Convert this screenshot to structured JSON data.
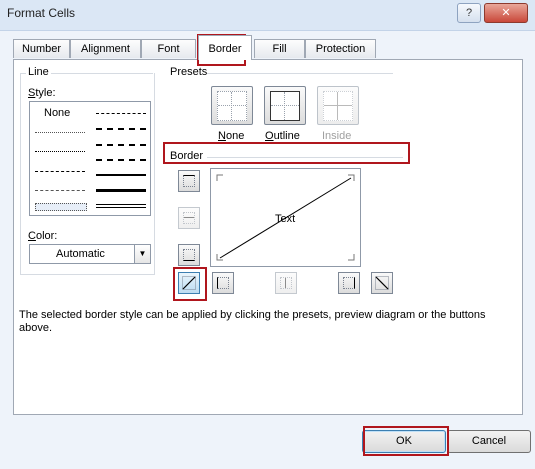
{
  "window": {
    "title": "Format Cells",
    "help_label": "?",
    "close_label": "✕"
  },
  "tabs": [
    {
      "label": "Number"
    },
    {
      "label": "Alignment"
    },
    {
      "label": "Font"
    },
    {
      "label": "Border",
      "active": true
    },
    {
      "label": "Fill"
    },
    {
      "label": "Protection"
    }
  ],
  "line": {
    "group_label": "Line",
    "style_label": "Style:",
    "style_none_label": "None",
    "color_label": "Color:",
    "color_value": "Automatic"
  },
  "presets": {
    "group_label": "Presets",
    "items": [
      {
        "label": "None"
      },
      {
        "label": "Outline"
      },
      {
        "label": "Inside",
        "disabled": true
      }
    ]
  },
  "border": {
    "group_label": "Border",
    "preview_text": "Text"
  },
  "description": "The selected border style can be applied by clicking the presets, preview diagram or the buttons above.",
  "buttons": {
    "ok": "OK",
    "cancel": "Cancel"
  },
  "colors": {
    "highlight": "#b0161d",
    "titlebar": "#dbe7f5",
    "panel": "#ffffff"
  }
}
